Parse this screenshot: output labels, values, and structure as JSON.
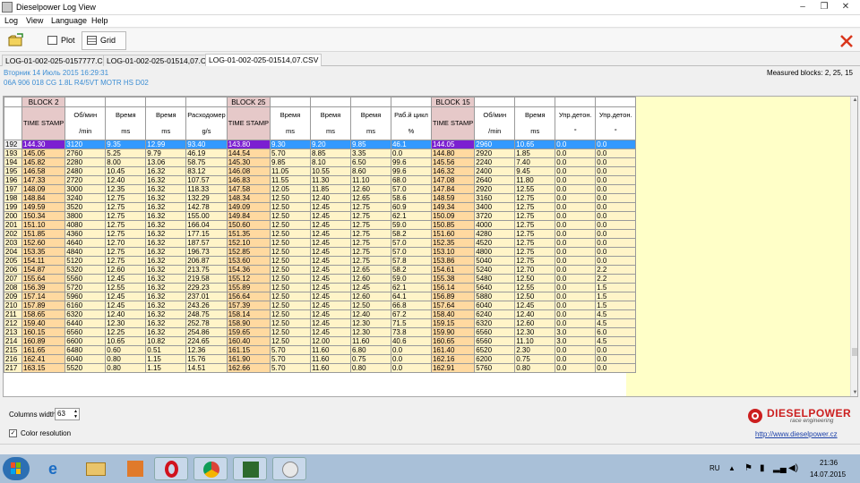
{
  "window": {
    "title": "Dieselpower Log View"
  },
  "menu": [
    "Log",
    "View",
    "Language",
    "Help"
  ],
  "toolbar": {
    "plot_label": "Plot",
    "grid_label": "Grid"
  },
  "file_tabs": [
    {
      "label": "LOG-01-002-025-0157777.CSV",
      "active": false
    },
    {
      "label": "LOG-01-002-025-01514,07.CSV",
      "active": false
    },
    {
      "label": "LOG-01-002-025-01514,07.CSV",
      "active": true
    }
  ],
  "info": {
    "date_line": "Вторник 14 Июль 2015 16:29:31",
    "ecu_line": "06A 906 018 CG  1.8L R4/5VT MOTR HS D02",
    "measured_blocks": "Measured blocks: 2, 25, 15"
  },
  "grid": {
    "blocks": [
      "BLOCK 2",
      "BLOCK 25",
      "BLOCK 15"
    ],
    "columns": [
      {
        "name": "TIME STAMP",
        "unit": "",
        "ts": true
      },
      {
        "name": "Об/мин",
        "unit": "/min"
      },
      {
        "name": "Время",
        "unit": "ms"
      },
      {
        "name": "Время",
        "unit": "ms"
      },
      {
        "name": "Расходомер",
        "unit": "g/s"
      },
      {
        "name": "TIME STAMP",
        "unit": "",
        "ts": true
      },
      {
        "name": "Время",
        "unit": "ms"
      },
      {
        "name": "Время",
        "unit": "ms"
      },
      {
        "name": "Время",
        "unit": "ms"
      },
      {
        "name": "Раб.й цикл",
        "unit": "%"
      },
      {
        "name": "TIME STAMP",
        "unit": "",
        "ts": true
      },
      {
        "name": "Об/мин",
        "unit": "/min"
      },
      {
        "name": "Время",
        "unit": "ms"
      },
      {
        "name": "Упр.детон.",
        "unit": "°"
      },
      {
        "name": "Упр.детон.",
        "unit": "°"
      }
    ],
    "selected_row": 192,
    "rows": [
      [
        "192",
        "144.30",
        "3120",
        "9.35",
        "12.99",
        "93.40",
        "143.80",
        "9.30",
        "9.20",
        "9.85",
        "46.1",
        "144.05",
        "2960",
        "10.65",
        "0.0",
        "0.0"
      ],
      [
        "193",
        "145.05",
        "2760",
        "5.25",
        "9.79",
        "46.19",
        "144.54",
        "5.70",
        "8.85",
        "3.35",
        "0.0",
        "144.80",
        "2920",
        "1.85",
        "0.0",
        "0.0"
      ],
      [
        "194",
        "145.82",
        "2280",
        "8.00",
        "13.06",
        "58.75",
        "145.30",
        "9.85",
        "8.10",
        "6.50",
        "99.6",
        "145.56",
        "2240",
        "7.40",
        "0.0",
        "0.0"
      ],
      [
        "195",
        "146.58",
        "2480",
        "10.45",
        "16.32",
        "83.12",
        "146.08",
        "11.05",
        "10.55",
        "8.60",
        "99.6",
        "146.32",
        "2400",
        "9.45",
        "0.0",
        "0.0"
      ],
      [
        "196",
        "147.33",
        "2720",
        "12.40",
        "16.32",
        "107.57",
        "146.83",
        "11.55",
        "11.30",
        "11.10",
        "68.0",
        "147.08",
        "2640",
        "11.80",
        "0.0",
        "0.0"
      ],
      [
        "197",
        "148.09",
        "3000",
        "12.35",
        "16.32",
        "118.33",
        "147.58",
        "12.05",
        "11.85",
        "12.60",
        "57.0",
        "147.84",
        "2920",
        "12.55",
        "0.0",
        "0.0"
      ],
      [
        "198",
        "148.84",
        "3240",
        "12.75",
        "16.32",
        "132.29",
        "148.34",
        "12.50",
        "12.40",
        "12.65",
        "58.6",
        "148.59",
        "3160",
        "12.75",
        "0.0",
        "0.0"
      ],
      [
        "199",
        "149.59",
        "3520",
        "12.75",
        "16.32",
        "142.78",
        "149.09",
        "12.50",
        "12.45",
        "12.75",
        "60.9",
        "149.34",
        "3400",
        "12.75",
        "0.0",
        "0.0"
      ],
      [
        "200",
        "150.34",
        "3800",
        "12.75",
        "16.32",
        "155.00",
        "149.84",
        "12.50",
        "12.45",
        "12.75",
        "62.1",
        "150.09",
        "3720",
        "12.75",
        "0.0",
        "0.0"
      ],
      [
        "201",
        "151.10",
        "4080",
        "12.75",
        "16.32",
        "166.04",
        "150.60",
        "12.50",
        "12.45",
        "12.75",
        "59.0",
        "150.85",
        "4000",
        "12.75",
        "0.0",
        "0.0"
      ],
      [
        "202",
        "151.85",
        "4360",
        "12.75",
        "16.32",
        "177.15",
        "151.35",
        "12.50",
        "12.45",
        "12.75",
        "58.2",
        "151.60",
        "4280",
        "12.75",
        "0.0",
        "0.0"
      ],
      [
        "203",
        "152.60",
        "4640",
        "12.70",
        "16.32",
        "187.57",
        "152.10",
        "12.50",
        "12.45",
        "12.75",
        "57.0",
        "152.35",
        "4520",
        "12.75",
        "0.0",
        "0.0"
      ],
      [
        "204",
        "153.35",
        "4840",
        "12.75",
        "16.32",
        "196.73",
        "152.85",
        "12.50",
        "12.45",
        "12.75",
        "57.0",
        "153.10",
        "4800",
        "12.75",
        "0.0",
        "0.0"
      ],
      [
        "205",
        "154.11",
        "5120",
        "12.75",
        "16.32",
        "206.87",
        "153.60",
        "12.50",
        "12.45",
        "12.75",
        "57.8",
        "153.86",
        "5040",
        "12.75",
        "0.0",
        "0.0"
      ],
      [
        "206",
        "154.87",
        "5320",
        "12.60",
        "16.32",
        "213.75",
        "154.36",
        "12.50",
        "12.45",
        "12.65",
        "58.2",
        "154.61",
        "5240",
        "12.70",
        "0.0",
        "2.2"
      ],
      [
        "207",
        "155.64",
        "5560",
        "12.45",
        "16.32",
        "219.58",
        "155.12",
        "12.50",
        "12.45",
        "12.60",
        "59.0",
        "155.38",
        "5480",
        "12.50",
        "0.0",
        "2.2"
      ],
      [
        "208",
        "156.39",
        "5720",
        "12.55",
        "16.32",
        "229.23",
        "155.89",
        "12.50",
        "12.45",
        "12.45",
        "62.1",
        "156.14",
        "5640",
        "12.55",
        "0.0",
        "1.5"
      ],
      [
        "209",
        "157.14",
        "5960",
        "12.45",
        "16.32",
        "237.01",
        "156.64",
        "12.50",
        "12.45",
        "12.60",
        "64.1",
        "156.89",
        "5880",
        "12.50",
        "0.0",
        "1.5"
      ],
      [
        "210",
        "157.89",
        "6160",
        "12.45",
        "16.32",
        "243.26",
        "157.39",
        "12.50",
        "12.45",
        "12.50",
        "66.8",
        "157.64",
        "6040",
        "12.45",
        "0.0",
        "1.5"
      ],
      [
        "211",
        "158.65",
        "6320",
        "12.40",
        "16.32",
        "248.75",
        "158.14",
        "12.50",
        "12.45",
        "12.40",
        "67.2",
        "158.40",
        "6240",
        "12.40",
        "0.0",
        "4.5"
      ],
      [
        "212",
        "159.40",
        "6440",
        "12.30",
        "16.32",
        "252.78",
        "158.90",
        "12.50",
        "12.45",
        "12.30",
        "71.5",
        "159.15",
        "6320",
        "12.60",
        "0.0",
        "4.5"
      ],
      [
        "213",
        "160.15",
        "6560",
        "12.25",
        "16.32",
        "254.86",
        "159.65",
        "12.50",
        "12.45",
        "12.30",
        "73.8",
        "159.90",
        "6560",
        "12.30",
        "3.0",
        "6.0"
      ],
      [
        "214",
        "160.89",
        "6600",
        "10.65",
        "10.82",
        "224.65",
        "160.40",
        "12.50",
        "12.00",
        "11.60",
        "40.6",
        "160.65",
        "6560",
        "11.10",
        "3.0",
        "4.5"
      ],
      [
        "215",
        "161.65",
        "6480",
        "0.60",
        "0.51",
        "12.36",
        "161.15",
        "5.70",
        "11.60",
        "6.80",
        "0.0",
        "161.40",
        "6520",
        "2.30",
        "0.0",
        "0.0"
      ],
      [
        "216",
        "162.41",
        "6040",
        "0.80",
        "1.15",
        "15.76",
        "161.90",
        "5.70",
        "11.60",
        "0.75",
        "0.0",
        "162.16",
        "6200",
        "0.75",
        "0.0",
        "0.0"
      ],
      [
        "217",
        "163.15",
        "5520",
        "0.80",
        "1.15",
        "14.51",
        "162.66",
        "5.70",
        "11.60",
        "0.80",
        "0.0",
        "162.91",
        "5760",
        "0.80",
        "0.0",
        "0.0"
      ]
    ]
  },
  "bottom": {
    "columns_width_label": "Columns width:",
    "columns_width_value": "63",
    "color_resolution_label": "Color resolution",
    "color_resolution_checked": true,
    "logo_main": "DIESELPOWER",
    "logo_sub": "race engineering",
    "url": "http://www.dieselpower.cz"
  },
  "taskbar": {
    "lang": "RU",
    "time": "21:36",
    "date": "14.07.2015"
  },
  "colors": {
    "selected_row": "#3399ff",
    "selected_ts": "#7b1fd1",
    "data_cell": "#fff4c8",
    "ts_cell": "#ffd9a0",
    "block_header": "#e6c9c9",
    "right_panel": "#ffffc8",
    "link": "#1a3fa8"
  }
}
